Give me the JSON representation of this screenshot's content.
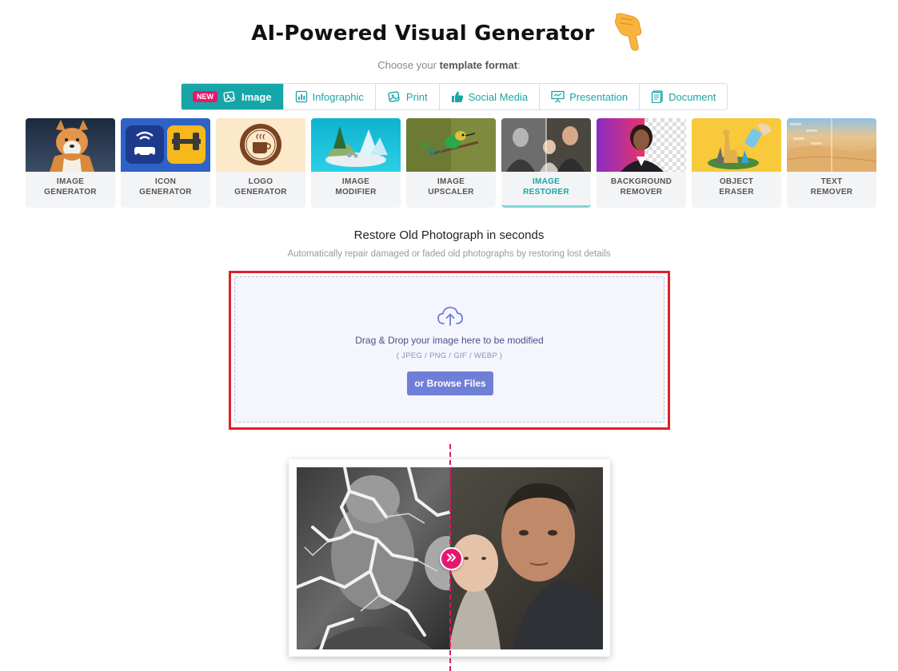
{
  "header": {
    "title": "AI-Powered Visual Generator",
    "subtitle_prefix": "Choose your ",
    "subtitle_bold": "template format",
    "subtitle_suffix": ":"
  },
  "format_tabs": [
    {
      "label": "Image",
      "badge": "NEW",
      "icon": "image-icon",
      "active": true
    },
    {
      "label": "Infographic",
      "icon": "bar-chart-icon",
      "active": false
    },
    {
      "label": "Print",
      "icon": "print-image-icon",
      "active": false
    },
    {
      "label": "Social Media",
      "icon": "thumbs-up-icon",
      "active": false
    },
    {
      "label": "Presentation",
      "icon": "presentation-icon",
      "active": false
    },
    {
      "label": "Document",
      "icon": "document-icon",
      "active": false
    }
  ],
  "tools": [
    {
      "label": "IMAGE\nGENERATOR",
      "active": false
    },
    {
      "label": "ICON\nGENERATOR",
      "active": false
    },
    {
      "label": "LOGO\nGENERATOR",
      "active": false
    },
    {
      "label": "IMAGE\nMODIFIER",
      "active": false
    },
    {
      "label": "IMAGE\nUPSCALER",
      "active": false
    },
    {
      "label": "IMAGE\nRESTORER",
      "active": true
    },
    {
      "label": "BACKGROUND\nREMOVER",
      "active": false
    },
    {
      "label": "OBJECT\nERASER",
      "active": false
    },
    {
      "label": "TEXT\nREMOVER",
      "active": false
    }
  ],
  "main": {
    "heading": "Restore Old Photograph in seconds",
    "description": "Automatically repair damaged or faded old photographs by restoring lost details"
  },
  "upload": {
    "icon": "cloud-upload-icon",
    "drop_text": "Drag & Drop your image here to be modified",
    "formats": "( JPEG / PNG / GIF / WEBP )",
    "browse_label": "or Browse Files"
  },
  "colors": {
    "accent": "#17a6a8",
    "badge": "#e8176d",
    "highlight_frame": "#e01f26",
    "browse_button": "#6f7fd8"
  }
}
